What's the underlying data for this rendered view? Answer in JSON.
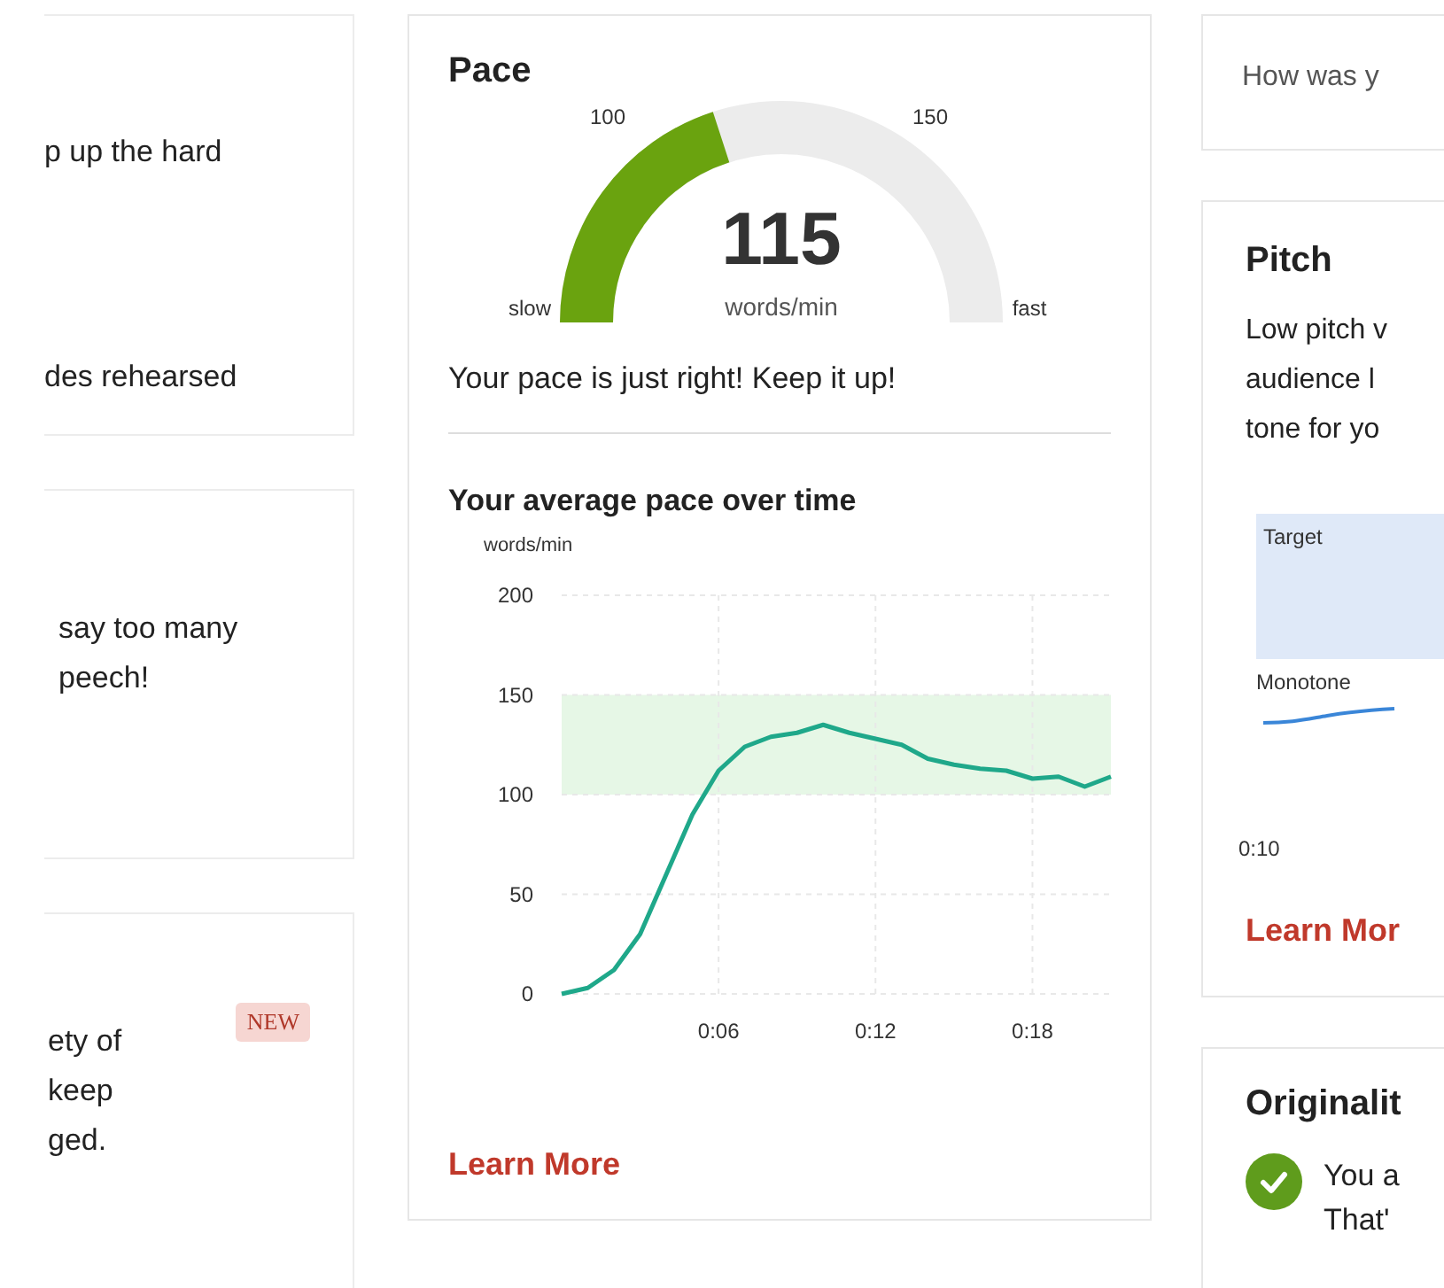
{
  "left_column": {
    "cards": [
      {
        "lines": [
          "p up the hard",
          "des rehearsed"
        ]
      },
      {
        "lines": [
          "say too many",
          "peech!"
        ]
      },
      {
        "badge": "NEW",
        "lines": [
          "ety of",
          "keep",
          "ged."
        ]
      }
    ]
  },
  "pace_card": {
    "title": "Pace",
    "gauge": {
      "value": "115",
      "unit": "words/min",
      "min_label": "slow",
      "max_label": "fast",
      "ticks": [
        "100",
        "150"
      ],
      "level": 0.4
    },
    "message": "Your pace is just right! Keep it up!",
    "chart_title": "Your average pace over time",
    "chart_data": {
      "type": "line",
      "ylabel": "words/min",
      "x": [
        0,
        1,
        2,
        3,
        4,
        5,
        6,
        7,
        8,
        9,
        10,
        11,
        12,
        13,
        14,
        15,
        16,
        17,
        18,
        19,
        20,
        21
      ],
      "series": [
        {
          "color": "#1fa88a",
          "values": [
            0,
            3,
            12,
            30,
            60,
            90,
            112,
            124,
            129,
            131,
            135,
            131,
            128,
            125,
            118,
            115,
            113,
            112,
            108,
            109,
            104,
            109
          ]
        }
      ],
      "xlim": [
        0,
        21
      ],
      "ylim": [
        0,
        200
      ],
      "xticks": [
        {
          "value": 6,
          "label": "0:06"
        },
        {
          "value": 12,
          "label": "0:12"
        },
        {
          "value": 18,
          "label": "0:18"
        }
      ],
      "yticks": [
        0,
        50,
        100,
        150,
        200
      ],
      "grid": true,
      "bands": [
        {
          "axis": "y",
          "from": 100,
          "to": 150
        }
      ]
    },
    "link": "Learn More"
  },
  "right_column": {
    "feedback_prompt": "How was y",
    "pitch_card": {
      "title": "Pitch",
      "description_lines": [
        "Low pitch v",
        "audience l",
        "tone for yo"
      ],
      "chart": {
        "target_label": "Target",
        "monotone_label": "Monotone",
        "time_label": "0:10"
      },
      "link": "Learn Mor"
    },
    "originality_card": {
      "title": "Originalit",
      "lines": [
        "You a",
        "That'"
      ]
    }
  }
}
